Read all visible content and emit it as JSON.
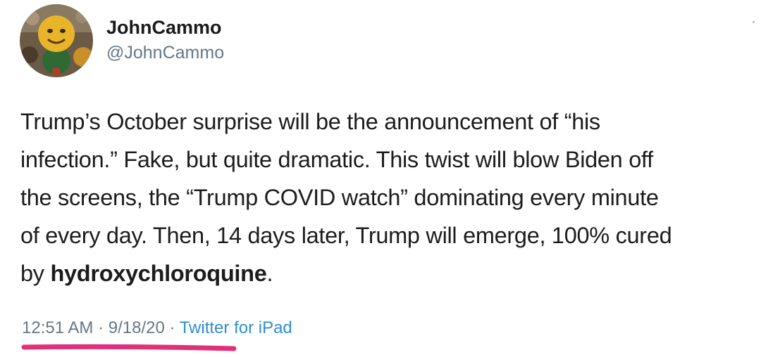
{
  "tweet": {
    "display_name": "JohnCammo",
    "handle": "@JohnCammo",
    "body_lines": [
      "Trump’s October surprise will be the announcement of “his",
      "infection.”  Fake, but quite dramatic. This twist will blow Biden off",
      "the screens, the “Trump COVID watch” dominating every minute",
      "of every day.  Then, 14 days later, Trump will emerge, 100% cured"
    ],
    "last_line_prefix": "by ",
    "last_line_bold": "hydroxychloroquine",
    "last_line_suffix": ".",
    "time": "12:51 AM",
    "date": "9/18/20",
    "separator": " · ",
    "source": "Twitter for iPad"
  },
  "colors": {
    "text": "#1c1c1c",
    "muted": "#657786",
    "link": "#2f8fd0",
    "highlight_underline": "#e0307a"
  }
}
